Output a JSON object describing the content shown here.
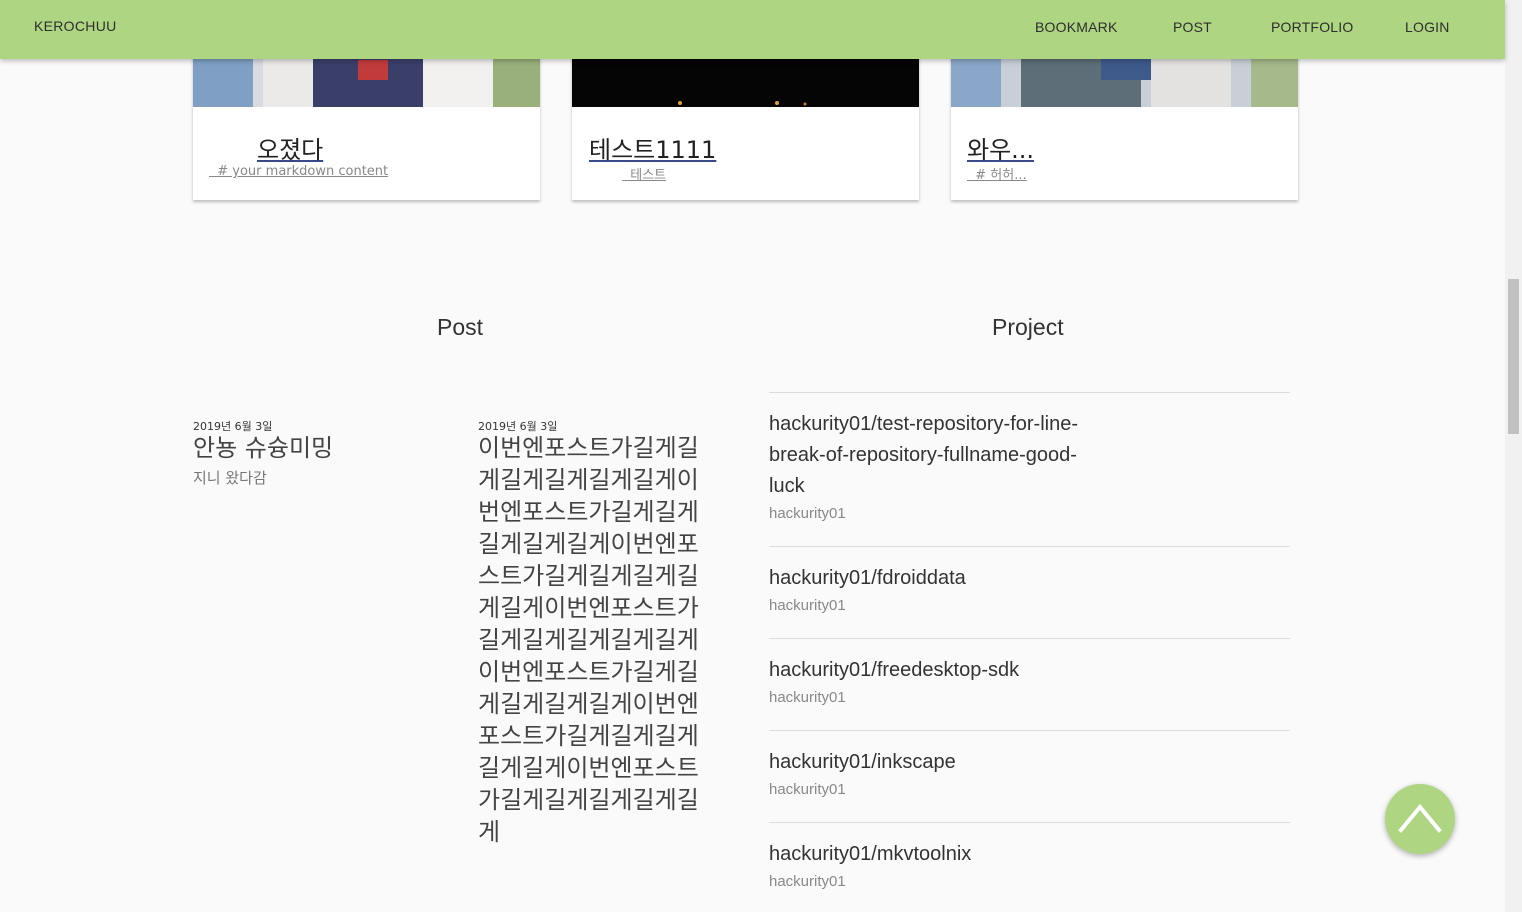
{
  "nav": {
    "brand": "KEROCHUU",
    "items": [
      "BOOKMARK",
      "POST",
      "PORTFOLIO",
      "LOGIN"
    ]
  },
  "cards": [
    {
      "title": "오졌다",
      "sub": "  # your markdown content"
    },
    {
      "title": "테스트1111",
      "sub": "  테스트"
    },
    {
      "title": "와우...",
      "sub": "  # 허허..."
    }
  ],
  "sections": {
    "post": "Post",
    "project": "Project"
  },
  "posts": [
    {
      "date": "2019년 6월 3일",
      "title": "안뇽 슈슝미밍",
      "sub": "지니 왔다감"
    },
    {
      "date": "2019년 6월 3일",
      "title": "이번엔포스트가길게길게길게길게길게길게이번엔포스트가길게길게길게길게길게이번엔포스트가길게길게길게길게길게이번엔포스트가길게길게길게길게길게이번엔포스트가길게길게길게길게길게이번엔포스트가길게길게길게길게길게이번엔포스트가길게길게길게길게길게"
    }
  ],
  "projects": [
    {
      "name": "hackurity01/test-repository-for-line-break-of-repository-fullname-good-luck",
      "owner": "hackurity01"
    },
    {
      "name": "hackurity01/fdroiddata",
      "owner": "hackurity01"
    },
    {
      "name": "hackurity01/freedesktop-sdk",
      "owner": "hackurity01"
    },
    {
      "name": "hackurity01/inkscape",
      "owner": "hackurity01"
    },
    {
      "name": "hackurity01/mkvtoolnix",
      "owner": "hackurity01"
    }
  ],
  "colors": {
    "accent": "#aed581",
    "background": "#fafafa"
  },
  "icons": {
    "fab": "chevron-up-icon"
  }
}
